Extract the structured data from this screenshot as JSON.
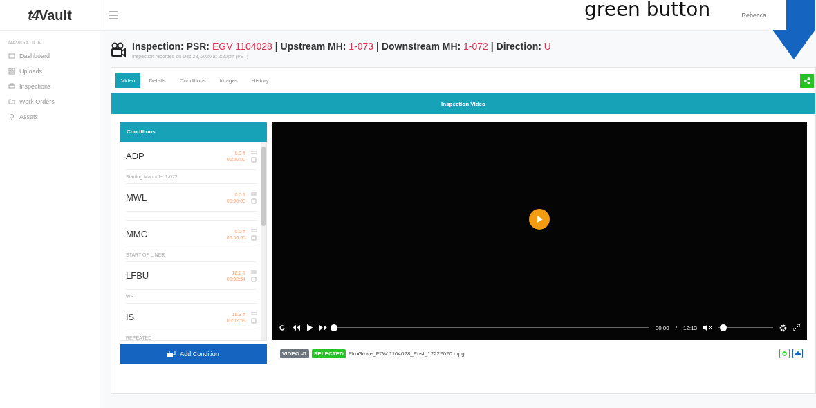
{
  "annotation": {
    "text": "green button"
  },
  "logo": {
    "text": "t4",
    "suffix": "Vault"
  },
  "sidebar": {
    "heading": "NAVIGATION",
    "items": [
      {
        "label": "Dashboard"
      },
      {
        "label": "Uploads"
      },
      {
        "label": "Inspections"
      },
      {
        "label": "Work Orders"
      },
      {
        "label": "Assets"
      }
    ]
  },
  "user": {
    "name": "Rebecca"
  },
  "inspection": {
    "title": "Inspection: PSR: **EGV 1104028** | Upstream MH: **1-073** | Downstream MH: **1-072** | Direction: **U**",
    "subtitle": "Inspection recorded on Dec 23, 2020 at 2:20pm (PST)"
  },
  "tabs": [
    {
      "label": "Video",
      "selected": true
    },
    {
      "label": "Details",
      "selected": false
    },
    {
      "label": "Conditions",
      "selected": false
    },
    {
      "label": "Images",
      "selected": false
    },
    {
      "label": "History",
      "selected": false
    }
  ],
  "section_title": "Inspection Video",
  "conditions": {
    "title": "Conditions",
    "items": [
      {
        "code": "ADP",
        "distance": "0.0 ft",
        "time": "00:00:00",
        "note": "Starting Manhole: 1-072"
      },
      {
        "code": "MWL",
        "distance": "0.0 ft",
        "time": "00:00:00"
      },
      {
        "code": "MMC",
        "distance": "0.0 ft",
        "time": "00:00:00",
        "note": "START OF LINER"
      },
      {
        "code": "LFBU",
        "distance": "18.2 ft",
        "time": "00:02:54",
        "note": "WR"
      },
      {
        "code": "IS",
        "distance": "18.3 ft",
        "time": "00:02:59",
        "note": "REPEATED"
      }
    ],
    "add_button": "Add Condition"
  },
  "player": {
    "current": "00:00",
    "separator": "/",
    "duration": "12:13",
    "progress": {
      "level": 0
    },
    "volume": {
      "level": 0.1
    }
  },
  "file": {
    "badges": [
      {
        "label": "VIDEO #1",
        "color": "#6c757d"
      },
      {
        "label": "SELECTED",
        "color": "#28c228"
      }
    ],
    "name": "ElmGrove_EGV 1104028_Post_12222020.mpg"
  }
}
